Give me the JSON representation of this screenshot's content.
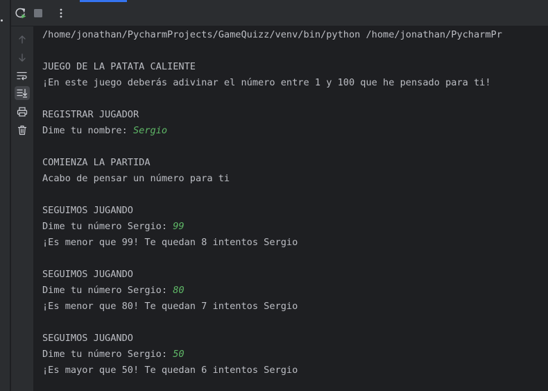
{
  "toolbar": {
    "icons": [
      "rerun-icon",
      "stop-icon",
      "more-options-icon"
    ]
  },
  "sidebar": {
    "icons": [
      "up-arrow-icon",
      "down-arrow-icon",
      "soft-wrap-icon",
      "scroll-to-end-icon",
      "print-icon",
      "clear-all-icon"
    ]
  },
  "console": {
    "lines": [
      {
        "text": "/home/jonathan/PycharmProjects/GameQuizz/venv/bin/python /home/jonathan/PycharmPr"
      },
      {
        "text": "JUEGO DE LA PATATA CALIENTE"
      },
      {
        "text": "¡En este juego deberás adivinar el número entre 1 y 100 que he pensado para ti!"
      },
      {
        "text": "REGISTRAR JUGADOR"
      },
      {
        "text": "Dime tu nombre: ",
        "input": "Sergio"
      },
      {
        "text": "COMIENZA LA PARTIDA"
      },
      {
        "text": "Acabo de pensar un número para ti"
      },
      {
        "text": "SEGUIMOS JUGANDO"
      },
      {
        "text": "Dime tu número Sergio: ",
        "input": "99"
      },
      {
        "text": "¡Es menor que 99! Te quedan 8 intentos Sergio"
      },
      {
        "text": "SEGUIMOS JUGANDO"
      },
      {
        "text": "Dime tu número Sergio: ",
        "input": "80"
      },
      {
        "text": "¡Es menor que 80! Te quedan 7 intentos Sergio"
      },
      {
        "text": "SEGUIMOS JUGANDO"
      },
      {
        "text": "Dime tu número Sergio: ",
        "input": "50"
      },
      {
        "text": "¡Es mayor que 50! Te quedan 6 intentos Sergio"
      }
    ]
  },
  "colors": {
    "background": "#1e1f22",
    "toolbar": "#2b2d30",
    "text": "#bcbec4",
    "input": "#5fb867",
    "accent": "#3574f0",
    "rerun_badge": "#5fb865"
  }
}
